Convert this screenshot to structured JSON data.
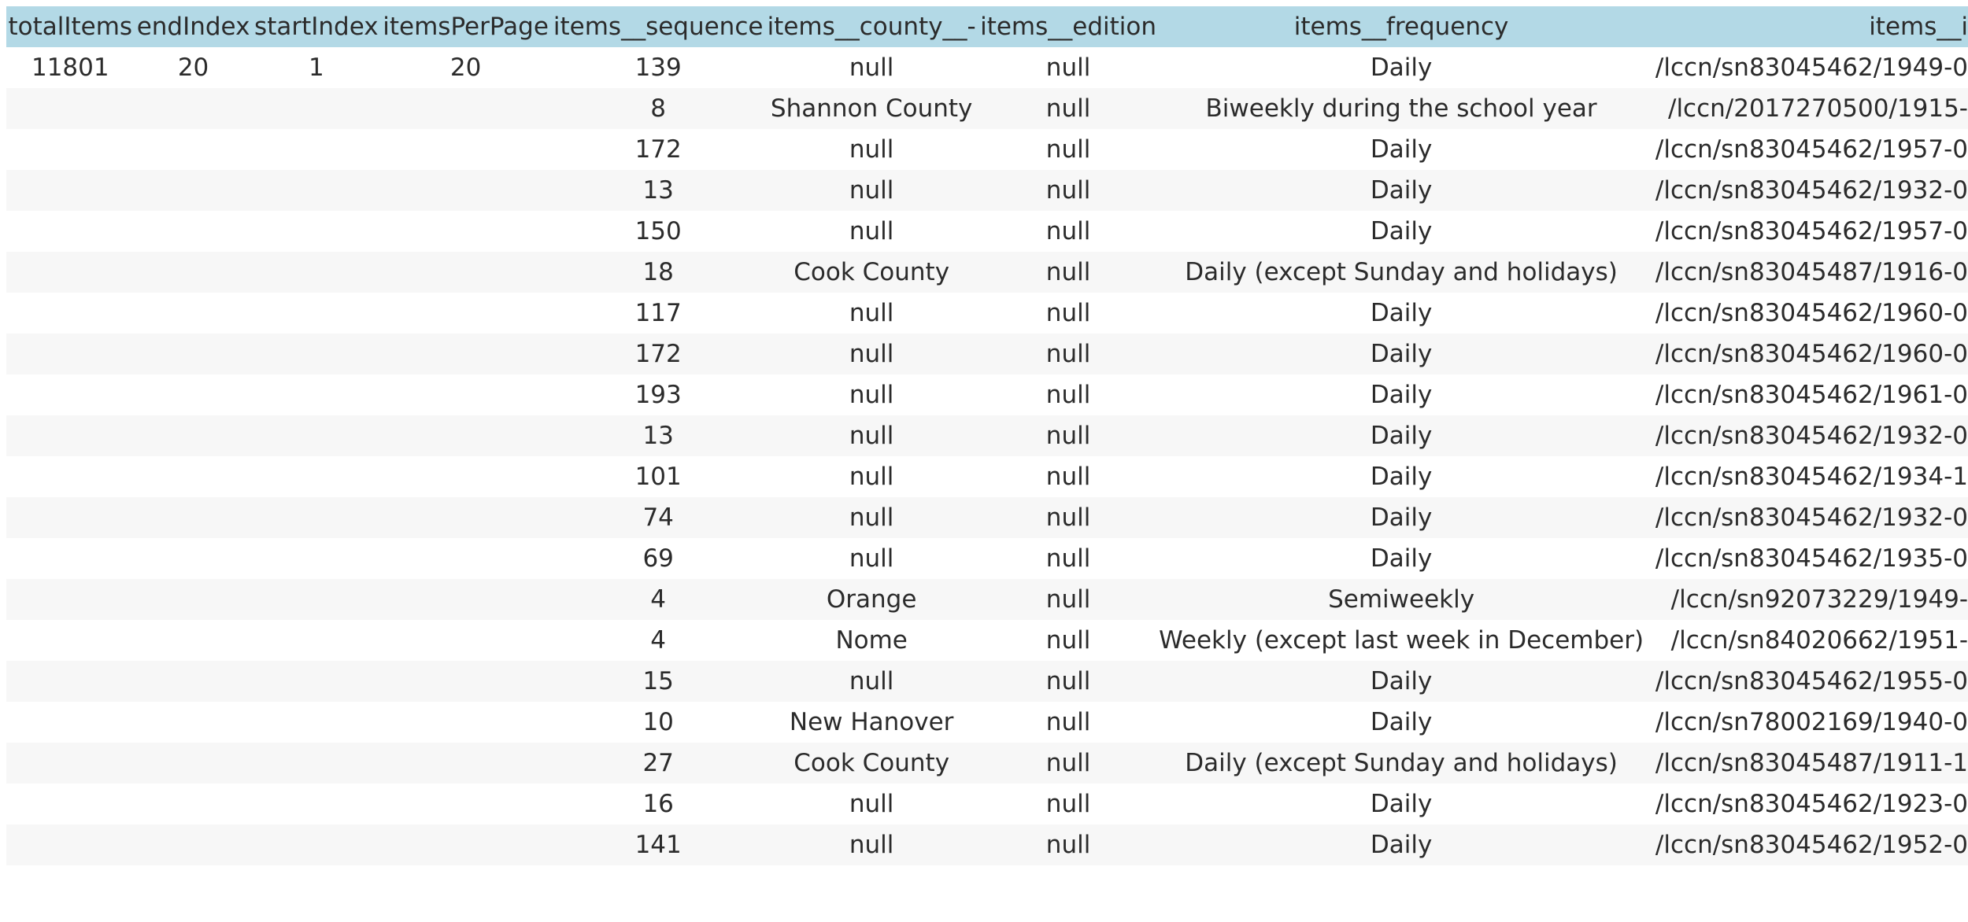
{
  "table": {
    "headers": [
      "totalItems",
      "endIndex",
      "startIndex",
      "itemsPerPage",
      "items__sequence",
      "items__county__-",
      "items__edition",
      "items__frequency",
      "items__i"
    ],
    "rows": [
      [
        "11801",
        "20",
        "1",
        "20",
        "139",
        "null",
        "null",
        "Daily",
        "/lccn/sn83045462/1949-0"
      ],
      [
        "",
        "",
        "",
        "",
        "8",
        "Shannon County",
        "null",
        "Biweekly during the school year",
        "/lccn/2017270500/1915-"
      ],
      [
        "",
        "",
        "",
        "",
        "172",
        "null",
        "null",
        "Daily",
        "/lccn/sn83045462/1957-0"
      ],
      [
        "",
        "",
        "",
        "",
        "13",
        "null",
        "null",
        "Daily",
        "/lccn/sn83045462/1932-0"
      ],
      [
        "",
        "",
        "",
        "",
        "150",
        "null",
        "null",
        "Daily",
        "/lccn/sn83045462/1957-0"
      ],
      [
        "",
        "",
        "",
        "",
        "18",
        "Cook County",
        "null",
        "Daily (except Sunday and holidays)",
        "/lccn/sn83045487/1916-0"
      ],
      [
        "",
        "",
        "",
        "",
        "117",
        "null",
        "null",
        "Daily",
        "/lccn/sn83045462/1960-0"
      ],
      [
        "",
        "",
        "",
        "",
        "172",
        "null",
        "null",
        "Daily",
        "/lccn/sn83045462/1960-0"
      ],
      [
        "",
        "",
        "",
        "",
        "193",
        "null",
        "null",
        "Daily",
        "/lccn/sn83045462/1961-0"
      ],
      [
        "",
        "",
        "",
        "",
        "13",
        "null",
        "null",
        "Daily",
        "/lccn/sn83045462/1932-0"
      ],
      [
        "",
        "",
        "",
        "",
        "101",
        "null",
        "null",
        "Daily",
        "/lccn/sn83045462/1934-1"
      ],
      [
        "",
        "",
        "",
        "",
        "74",
        "null",
        "null",
        "Daily",
        "/lccn/sn83045462/1932-0"
      ],
      [
        "",
        "",
        "",
        "",
        "69",
        "null",
        "null",
        "Daily",
        "/lccn/sn83045462/1935-0"
      ],
      [
        "",
        "",
        "",
        "",
        "4",
        "Orange",
        "null",
        "Semiweekly",
        "/lccn/sn92073229/1949-"
      ],
      [
        "",
        "",
        "",
        "",
        "4",
        "Nome",
        "null",
        "Weekly (except last week in December)",
        "/lccn/sn84020662/1951-"
      ],
      [
        "",
        "",
        "",
        "",
        "15",
        "null",
        "null",
        "Daily",
        "/lccn/sn83045462/1955-0"
      ],
      [
        "",
        "",
        "",
        "",
        "10",
        "New Hanover",
        "null",
        "Daily",
        "/lccn/sn78002169/1940-0"
      ],
      [
        "",
        "",
        "",
        "",
        "27",
        "Cook County",
        "null",
        "Daily (except Sunday and holidays)",
        "/lccn/sn83045487/1911-1"
      ],
      [
        "",
        "",
        "",
        "",
        "16",
        "null",
        "null",
        "Daily",
        "/lccn/sn83045462/1923-0"
      ],
      [
        "",
        "",
        "",
        "",
        "141",
        "null",
        "null",
        "Daily",
        "/lccn/sn83045462/1952-0"
      ]
    ]
  },
  "colors": {
    "header_bg": "#b3d9e6",
    "stripe_bg": "#f7f7f7",
    "text": "#2b2b2b"
  }
}
